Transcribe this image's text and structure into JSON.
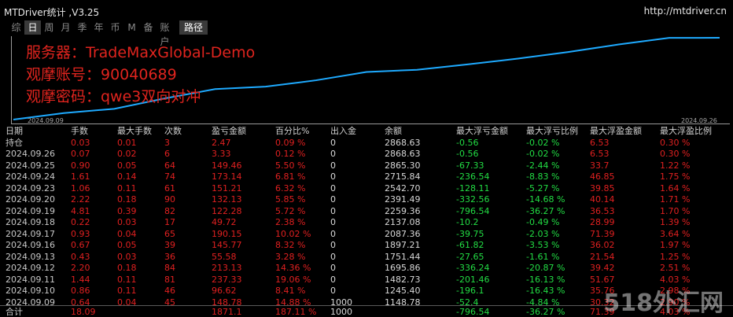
{
  "title": "MTDriver统计 ,V3.25",
  "url": "http://mtdriver.cn",
  "tabs": [
    "综",
    "日",
    "周",
    "月",
    "季",
    "年",
    "币",
    "M",
    "备",
    "账户"
  ],
  "active_tab": "日",
  "route_button": "路径",
  "overlay": {
    "server": "服务器：TradeMaxGlobal-Demo",
    "account": "观摩账号：90040689",
    "password": "观摩密码：qwe3双向对冲"
  },
  "chart": {
    "start_date": "2024.09.09",
    "end_date": "2024.09.26",
    "line_color": "#1eaaff"
  },
  "headers": [
    "日期",
    "手数",
    "最大手数",
    "次数",
    "盈亏金额",
    "百分比%",
    "出入金",
    "余额",
    "最大浮亏金额",
    "最大浮亏比例",
    "最大浮盈金额",
    "最大浮盈比例"
  ],
  "rows": [
    [
      "持仓",
      "0.03",
      "0.01",
      "3",
      "2.47",
      "0.09 %",
      "0",
      "2868.63",
      "-0.56",
      "-0.02 %",
      "6.53",
      "0.30 %"
    ],
    [
      "2024.09.26",
      "0.07",
      "0.02",
      "6",
      "3.33",
      "0.12 %",
      "0",
      "2868.63",
      "-0.56",
      "-0.02 %",
      "6.53",
      "0.30 %"
    ],
    [
      "2024.09.25",
      "0.90",
      "0.05",
      "64",
      "149.46",
      "5.50 %",
      "0",
      "2865.30",
      "-67.33",
      "-2.44 %",
      "33.7",
      "1.22 %"
    ],
    [
      "2024.09.24",
      "1.61",
      "0.14",
      "74",
      "173.14",
      "6.81 %",
      "0",
      "2715.84",
      "-236.54",
      "-8.83 %",
      "46.85",
      "1.75 %"
    ],
    [
      "2024.09.23",
      "1.06",
      "0.11",
      "61",
      "151.21",
      "6.32 %",
      "0",
      "2542.70",
      "-128.11",
      "-5.27 %",
      "39.85",
      "1.64 %"
    ],
    [
      "2024.09.20",
      "2.22",
      "0.18",
      "90",
      "132.13",
      "5.85 %",
      "0",
      "2391.49",
      "-332.56",
      "-14.68 %",
      "40.14",
      "1.71 %"
    ],
    [
      "2024.09.19",
      "4.81",
      "0.39",
      "82",
      "122.28",
      "5.72 %",
      "0",
      "2259.36",
      "-796.54",
      "-36.27 %",
      "36.53",
      "1.70 %"
    ],
    [
      "2024.09.18",
      "0.22",
      "0.03",
      "17",
      "49.72",
      "2.38 %",
      "0",
      "2137.08",
      "-10.2",
      "-0.49 %",
      "28.99",
      "1.39 %"
    ],
    [
      "2024.09.17",
      "0.93",
      "0.04",
      "65",
      "190.15",
      "10.02 %",
      "0",
      "2087.36",
      "-39.75",
      "-2.03 %",
      "71.39",
      "3.64 %"
    ],
    [
      "2024.09.16",
      "0.67",
      "0.05",
      "39",
      "145.77",
      "8.32 %",
      "0",
      "1897.21",
      "-61.82",
      "-3.53 %",
      "36.02",
      "1.97 %"
    ],
    [
      "2024.09.13",
      "0.43",
      "0.03",
      "36",
      "55.58",
      "3.28 %",
      "0",
      "1751.44",
      "-27.65",
      "-1.61 %",
      "21.54",
      "1.25 %"
    ],
    [
      "2024.09.12",
      "2.20",
      "0.18",
      "84",
      "213.13",
      "14.36 %",
      "0",
      "1695.86",
      "-336.24",
      "-20.87 %",
      "39.42",
      "2.51 %"
    ],
    [
      "2024.09.11",
      "1.44",
      "0.11",
      "81",
      "237.33",
      "19.06 %",
      "0",
      "1482.73",
      "-201.46",
      "-16.13 %",
      "51.67",
      "4.03 %"
    ],
    [
      "2024.09.10",
      "0.86",
      "0.11",
      "46",
      "96.62",
      "8.41 %",
      "0",
      "1245.40",
      "-196.1",
      "-16.43 %",
      "35.76",
      "2.98 %"
    ],
    [
      "2024.09.09",
      "0.64",
      "0.04",
      "45",
      "148.78",
      "14.88 %",
      "1000",
      "1148.78",
      "-52.4",
      "-4.84 %",
      "30.32",
      "2.90 %"
    ]
  ],
  "total": [
    "合计",
    "18.09",
    "",
    "",
    "1871.1",
    "187.11 %",
    "1000",
    "",
    "-796.54",
    "-36.27 %",
    "71.39",
    "4.03 %"
  ],
  "watermark": "518外汇网",
  "equity_series": [
    1000,
    1148.78,
    1245.4,
    1482.73,
    1695.86,
    1751.44,
    1897.21,
    2087.36,
    2137.08,
    2259.36,
    2391.49,
    2542.7,
    2715.84,
    2865.3,
    2868.63
  ]
}
